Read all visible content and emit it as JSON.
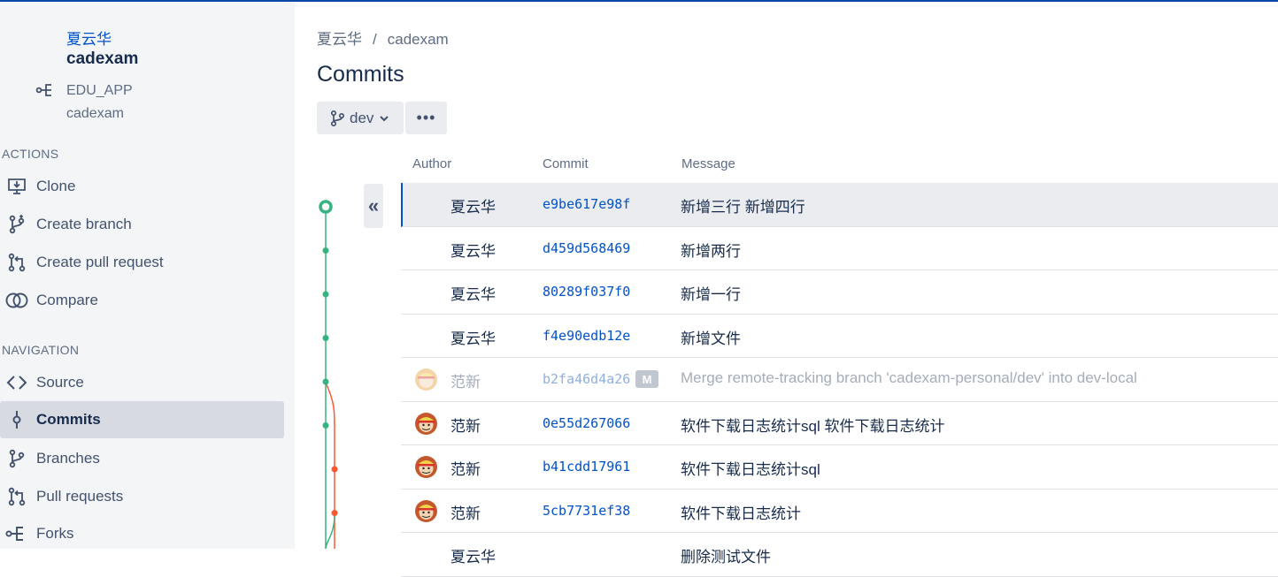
{
  "repo": {
    "owner": "夏云华",
    "name": "cadexam",
    "fork_parent_project": "EDU_APP",
    "fork_parent_repo": "cadexam"
  },
  "sidebar": {
    "actions_title": "ACTIONS",
    "actions": [
      {
        "label": "Clone",
        "icon": "clone-icon"
      },
      {
        "label": "Create branch",
        "icon": "branch-icon"
      },
      {
        "label": "Create pull request",
        "icon": "pull-request-icon"
      },
      {
        "label": "Compare",
        "icon": "compare-icon"
      }
    ],
    "navigation_title": "NAVIGATION",
    "navigation": [
      {
        "label": "Source",
        "icon": "code-icon"
      },
      {
        "label": "Commits",
        "icon": "commit-icon",
        "active": true
      },
      {
        "label": "Branches",
        "icon": "branch-icon"
      },
      {
        "label": "Pull requests",
        "icon": "pull-request-icon"
      },
      {
        "label": "Forks",
        "icon": "fork-icon"
      }
    ]
  },
  "breadcrumb": {
    "owner": "夏云华",
    "separator": "/",
    "repo": "cadexam"
  },
  "page_title": "Commits",
  "branch_selector": {
    "value": "dev"
  },
  "more_label": "•••",
  "collapse_label": "«",
  "table": {
    "headers": {
      "author": "Author",
      "commit": "Commit",
      "message": "Message"
    },
    "rows": [
      {
        "author": "夏云华",
        "hash": "e9be617e98f",
        "message": "新增三行 新增四行"
      },
      {
        "author": "夏云华",
        "hash": "d459d568469",
        "message": "新增两行"
      },
      {
        "author": "夏云华",
        "hash": "80289f037f0",
        "message": "新增一行"
      },
      {
        "author": "夏云华",
        "hash": "f4e90edb12e",
        "message": "新增文件"
      },
      {
        "author": "范新",
        "hash": "b2fa46d4a26",
        "badge": "M",
        "message": "Merge remote-tracking branch 'cadexam-personal/dev' into dev-local"
      },
      {
        "author": "范新",
        "hash": "0e55d267066",
        "message": "软件下载日志统计sql 软件下载日志统计"
      },
      {
        "author": "范新",
        "hash": "b41cdd17961",
        "message": "软件下载日志统计sql"
      },
      {
        "author": "范新",
        "hash": "5cb7731ef38",
        "message": "软件下载日志统计"
      },
      {
        "author": "夏云华",
        "hash": "",
        "message": "删除测试文件"
      }
    ]
  },
  "colors": {
    "accent": "#0052cc",
    "graph_main": "#36b37e",
    "graph_branch": "#ff5630",
    "sidebar_bg": "#f4f5f7",
    "selected_row_bg": "#ebecf0"
  }
}
